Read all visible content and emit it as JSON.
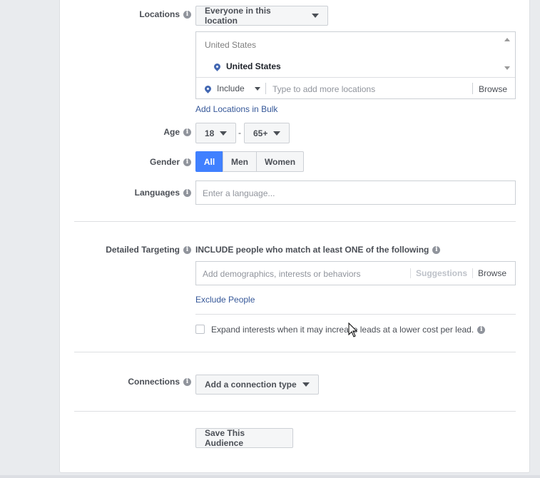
{
  "locations": {
    "label": "Locations",
    "scope_dropdown": "Everyone in this location",
    "list_header": "United States",
    "selected_item": "United States",
    "include_dropdown": "Include",
    "search_placeholder": "Type to add more locations",
    "browse": "Browse",
    "bulk_link": "Add Locations in Bulk"
  },
  "age": {
    "label": "Age",
    "min": "18",
    "separator": "-",
    "max": "65+"
  },
  "gender": {
    "label": "Gender",
    "options": [
      "All",
      "Men",
      "Women"
    ],
    "selected": "All"
  },
  "languages": {
    "label": "Languages",
    "placeholder": "Enter a language..."
  },
  "detailed_targeting": {
    "label": "Detailed Targeting",
    "include_text": "INCLUDE people who match at least ONE of the following",
    "search_placeholder": "Add demographics, interests or behaviors",
    "suggestions": "Suggestions",
    "browse": "Browse",
    "exclude_link": "Exclude People",
    "expand_text": "Expand interests when it may increase leads at a lower cost per lead."
  },
  "connections": {
    "label": "Connections",
    "dropdown": "Add a connection type"
  },
  "save_button": "Save This Audience",
  "colors": {
    "accent": "#4080ff",
    "link": "#365899",
    "pin": "#4267b2"
  }
}
